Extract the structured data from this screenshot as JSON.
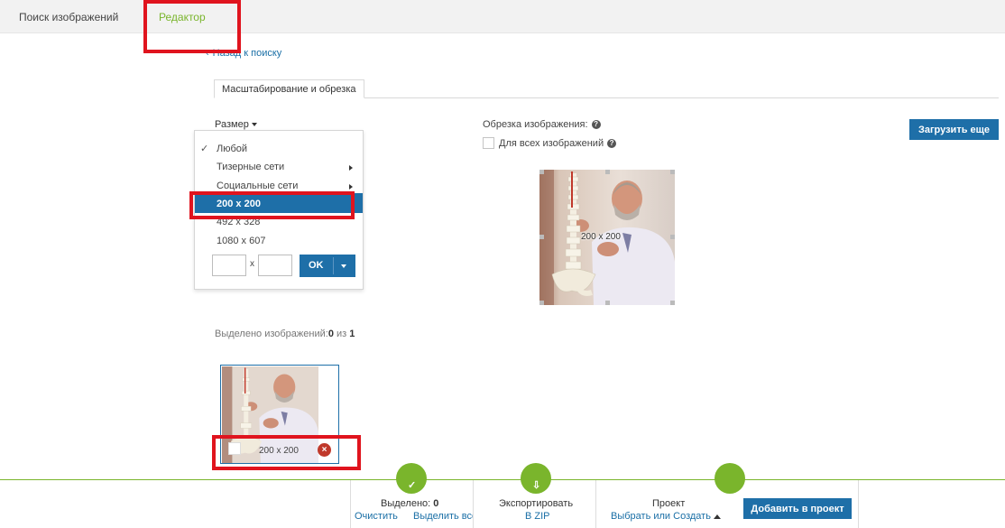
{
  "top_tabs": [
    {
      "label": "Поиск изображений"
    },
    {
      "label": "Редактор"
    }
  ],
  "back_link": {
    "label": "Назад к поиску"
  },
  "sub_tab": {
    "label": "Масштабирование и обрезка"
  },
  "size_control": {
    "label": "Размер"
  },
  "size_menu": {
    "items": [
      {
        "label": "Любой"
      },
      {
        "label": "Тизерные сети"
      },
      {
        "label": "Социальные сети"
      },
      {
        "label": "200 х 200"
      },
      {
        "label": "492 х 328"
      },
      {
        "label": "1080 х 607"
      }
    ],
    "width_value": "",
    "height_value": "",
    "separator": "x",
    "ok_label": "OK"
  },
  "crop": {
    "label": "Обрезка изображения:",
    "apply_all_label": "Для всех изображений",
    "image_dims": "200 х 200"
  },
  "load_more": {
    "label": "Загрузить еще"
  },
  "selection": {
    "prefix": "Выделено изображений:",
    "count": "0",
    "of": "из",
    "total": "1"
  },
  "thumbnail": {
    "dims": "200 х 200"
  },
  "bottom_bar": {
    "selected_label": "Выделено:",
    "selected_count": "0",
    "clear_label": "Очистить",
    "select_all_label": "Выделить все",
    "export_label": "Экспортировать",
    "export_format": "В ZIP",
    "project_label": "Проект",
    "project_choose": "Выбрать или Создать",
    "add_to_project": "Добавить в проект"
  },
  "colors": {
    "accent_blue": "#1e6fa8",
    "accent_green": "#7ab52c",
    "annotation_red": "#e0141e"
  },
  "icons": [
    "check-icon",
    "help-icon",
    "submenu-arrow-icon",
    "remove-icon",
    "download-icon",
    "caret-up-icon",
    "back-arrow-icon"
  ]
}
